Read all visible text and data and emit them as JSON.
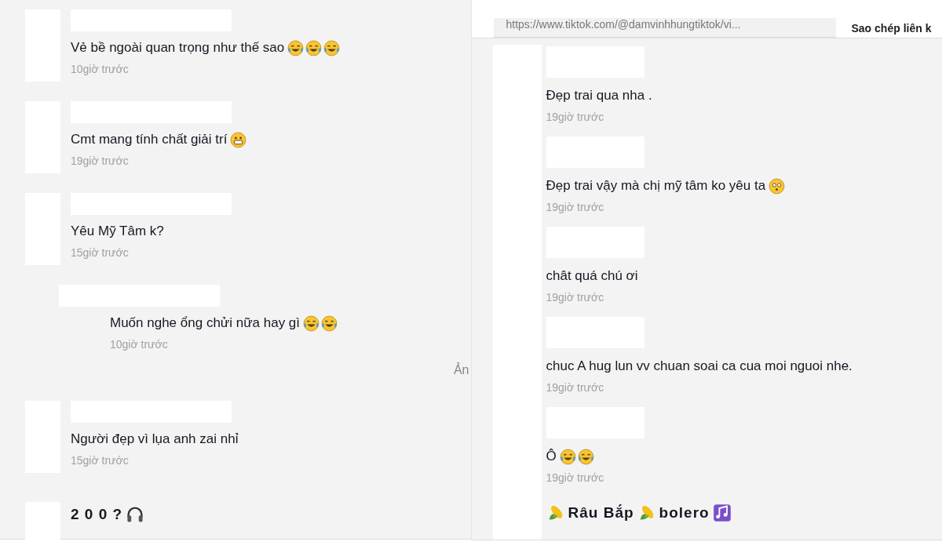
{
  "left_panel": {
    "items": [
      {
        "kind": "comment",
        "text": "Vẻ bề ngoài quan trọng như thế sao",
        "emojis": [
          {
            "kind": "laugh"
          },
          {
            "kind": "laugh"
          },
          {
            "kind": "laugh"
          }
        ],
        "time": "10giờ trước"
      },
      {
        "kind": "comment",
        "text": "Cmt mang tính chất giải trí",
        "emojis": [
          {
            "kind": "grin"
          }
        ],
        "time": "19giờ trước"
      },
      {
        "kind": "comment",
        "text": "Yêu Mỹ Tâm k?",
        "time": "15giờ trước",
        "replies": [
          {
            "text": "Muốn nghe ổng chửi nữa hay gì",
            "emojis": [
              {
                "kind": "laugh"
              },
              {
                "kind": "laugh"
              }
            ],
            "time": "10giờ trước"
          }
        ]
      },
      {
        "kind": "link",
        "text": "Ản"
      },
      {
        "kind": "comment",
        "text": "Người đẹp vì lụa anh zai nhỉ",
        "time": "15giờ trước"
      },
      {
        "kind": "user",
        "parts": [
          {
            "kind": "text",
            "text": "2 0 0 ?"
          },
          {
            "kind": "headphones"
          }
        ]
      }
    ]
  },
  "right_panel": {
    "link_field": {
      "value": "https://www.tiktok.com/@damvinhhungtiktok/vi..."
    },
    "copy_button": "Sao chép liên k",
    "items": [
      {
        "kind": "comment",
        "text": "Đẹp trai qua nha .",
        "time": "19giờ trước"
      },
      {
        "kind": "comment",
        "text": "Đẹp trai vậy mà chị mỹ tâm ko yêu ta",
        "emojis": [
          {
            "kind": "flushed"
          }
        ],
        "time": "19giờ trước"
      },
      {
        "kind": "comment",
        "text": "chât quá chú ơi",
        "time": "19giờ trước"
      },
      {
        "kind": "comment",
        "text": "chuc A hug lun vv chuan soai ca cua moi nguoi nhe.",
        "time": "19giờ trước"
      },
      {
        "kind": "comment",
        "text": "Ô",
        "emojis": [
          {
            "kind": "laugh"
          },
          {
            "kind": "laugh"
          }
        ],
        "time": "19giờ trước"
      },
      {
        "kind": "user",
        "parts": [
          {
            "kind": "corn"
          },
          {
            "kind": "text",
            "text": "Râu Bắp"
          },
          {
            "kind": "corn"
          },
          {
            "kind": "text",
            "text": "bolero"
          },
          {
            "kind": "music"
          }
        ]
      }
    ]
  }
}
